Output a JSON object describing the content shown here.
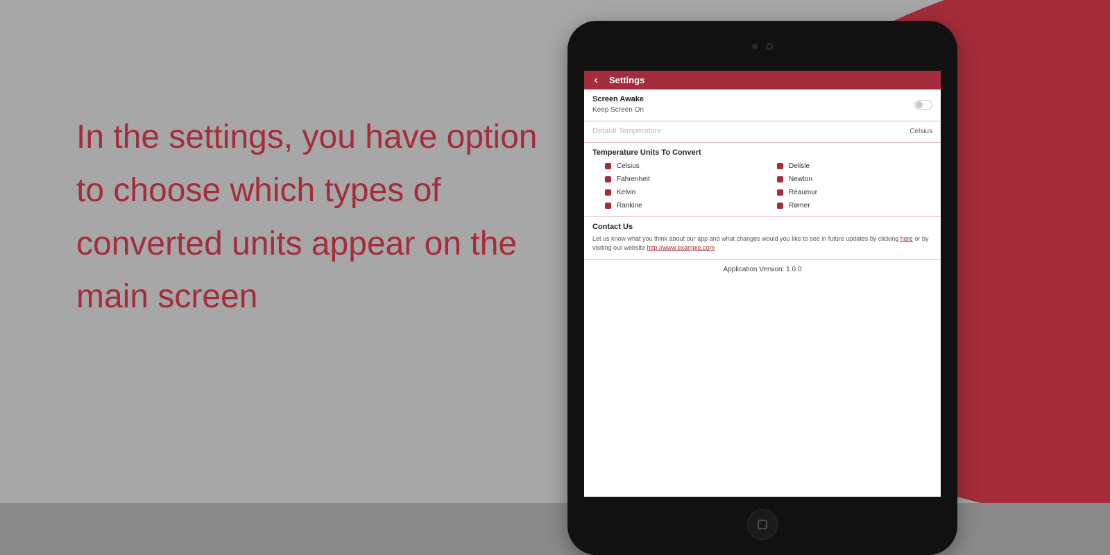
{
  "marketing": {
    "headline": "In the settings, you have option to choose which types of converted units appear on the main screen"
  },
  "app": {
    "title": "Settings",
    "screen_awake": {
      "title": "Screen Awake",
      "subtitle": "Keep Screen On"
    },
    "default_temp": {
      "label": "Default Temperature",
      "value": "Celsius"
    },
    "units": {
      "heading": "Temperature Units To Convert",
      "left": [
        "Celsius",
        "Fahrenheit",
        "Kelvin",
        "Rankine"
      ],
      "right": [
        "Delisle",
        "Newton",
        "Réaumur",
        "Rømer"
      ]
    },
    "contact": {
      "heading": "Contact Us",
      "body_pre": "Let us know what you think about our app and what changes would you like to see in future updates by clicking ",
      "link1": "here",
      "body_mid": " or by visiting our website ",
      "link2": "http://www.example.com"
    },
    "version_label": "Application Version: 1.0.0"
  }
}
